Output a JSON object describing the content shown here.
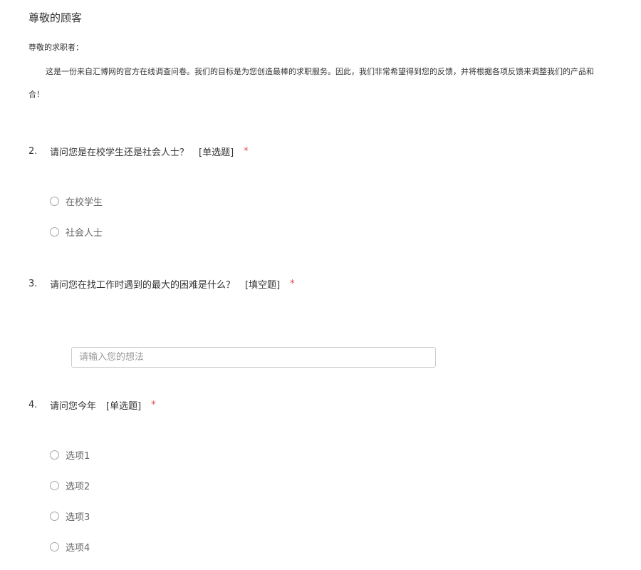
{
  "header": {
    "title": "尊敬的顾客"
  },
  "intro": {
    "greeting": "尊敬的求职者：",
    "line1": "这是一份来自汇博网的官方在线调查问卷。我们的目标是为您创造最棒的求职服务。因此，我们非常希望得到您的反馈，并将根据各项反馈来调整我们的产品和",
    "line2": "合！"
  },
  "questions": [
    {
      "number": "2.",
      "text": "请问您是在校学生还是社会人士？",
      "type": "[单选题]",
      "required": "*",
      "options": [
        "在校学生",
        "社会人士"
      ]
    },
    {
      "number": "3.",
      "text": "请问您在找工作时遇到的最大的困难是什么？",
      "type": "[填空题]",
      "required": "*",
      "placeholder": "请输入您的想法"
    },
    {
      "number": "4.",
      "text": "请问您今年",
      "type": "[单选题]",
      "required": "*",
      "options": [
        "选项1",
        "选项2",
        "选项3",
        "选项4"
      ]
    }
  ],
  "colors": {
    "required": "#e04b4b",
    "text": "#333333",
    "option_text": "#666666"
  }
}
